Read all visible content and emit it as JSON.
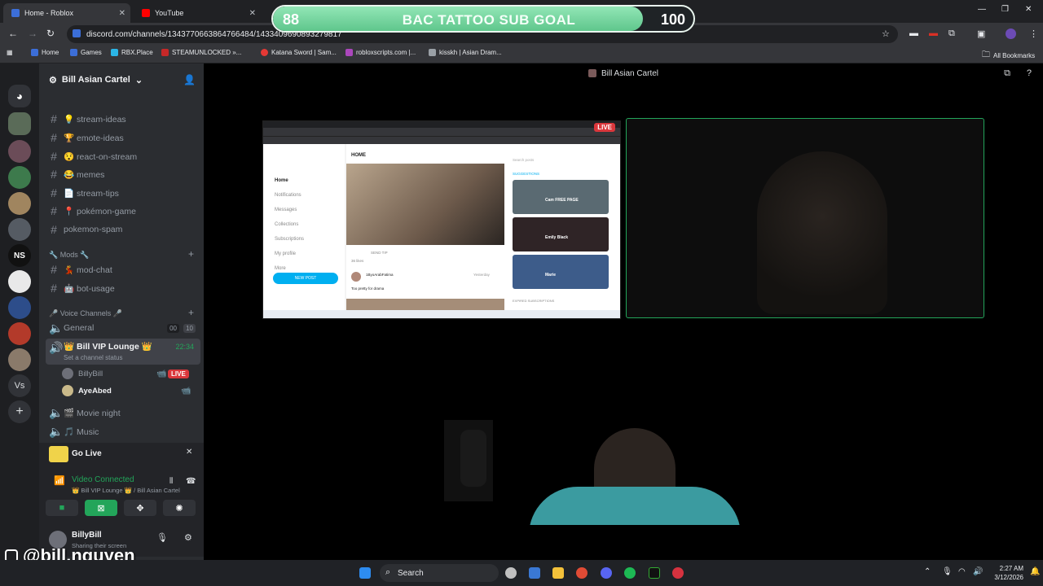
{
  "browser": {
    "tabs": [
      {
        "title": "Home - Roblox"
      },
      {
        "title": "YouTube"
      }
    ],
    "address": "discord.com/channels/1343770663864766484/1433409690893279817",
    "bookmarks": [
      "Home",
      "Games",
      "RBX.Place",
      "STEAMUNLOCKED »...",
      "Katana Sword | Sam...",
      "robloxscripts.com |...",
      "kisskh | Asian Dram...",
      "All Bookmarks"
    ]
  },
  "overlay": {
    "current": "88",
    "title": "BAC TATTOO SUB GOAL",
    "max": "100",
    "progress": 0.88,
    "watermark": "@bill.nguyen"
  },
  "discord": {
    "guild": "Bill Asian Cartel",
    "channels": [
      {
        "name": "💡 stream-ideas"
      },
      {
        "name": "🏆 emote-ideas"
      },
      {
        "name": "😯 react-on-stream"
      },
      {
        "name": "😂 memes"
      },
      {
        "name": "📄 stream-tips"
      },
      {
        "name": "📍 pokémon-game"
      },
      {
        "name": "pokemon-spam"
      }
    ],
    "mods_category": "🔧 Mods 🔧",
    "mod_channels": [
      {
        "name": "💃 mod-chat"
      },
      {
        "name": "🤖 bot-usage"
      }
    ],
    "voice_category": "🎤 Voice Channels 🎤",
    "voice_general": {
      "name": "General",
      "count_a": "00",
      "count_b": "10"
    },
    "voice_vip": {
      "name": "👑 Bill VIP Lounge 👑",
      "time": "22:34",
      "status": "Set a channel status"
    },
    "voice_users": [
      {
        "name": "BillyBill",
        "badge": "LIVE"
      },
      {
        "name": "AyeAbed"
      }
    ],
    "voice_more": [
      {
        "name": "🎬 Movie night"
      },
      {
        "name": "🎵 Music"
      }
    ],
    "go_live": "Go Live",
    "video_connected": "Video Connected",
    "connected_to": "👑 Bill VIP Lounge 👑 / Bill Asian Cartel",
    "user_name": "BillyBill",
    "user_status": "Sharing their screen",
    "stage_title": "Bill Asian Cartel",
    "live_badge": "LIVE"
  },
  "shared_screen": {
    "nav": [
      "Home",
      "Notifications",
      "Messages",
      "Collections",
      "Subscriptions",
      "My profile",
      "More"
    ],
    "new_post": "NEW POST",
    "header": "HOME",
    "suggestions": "SUGGESTIONS",
    "search": "Search posts",
    "cards": [
      "Cam FREE PAGE",
      "Emily Black",
      "Marie"
    ],
    "comment_user": "1ByoArabFatima",
    "comment_text": "Too pretty for drama",
    "likes": "36 likes",
    "send_tip": "SEND TIP",
    "yesterday": "Yesterday",
    "expired": "EXPIRED SUBSCRIPTIONS"
  },
  "taskbar": {
    "search": "Search",
    "time": "2:27 AM",
    "date": "3/12/2026"
  }
}
